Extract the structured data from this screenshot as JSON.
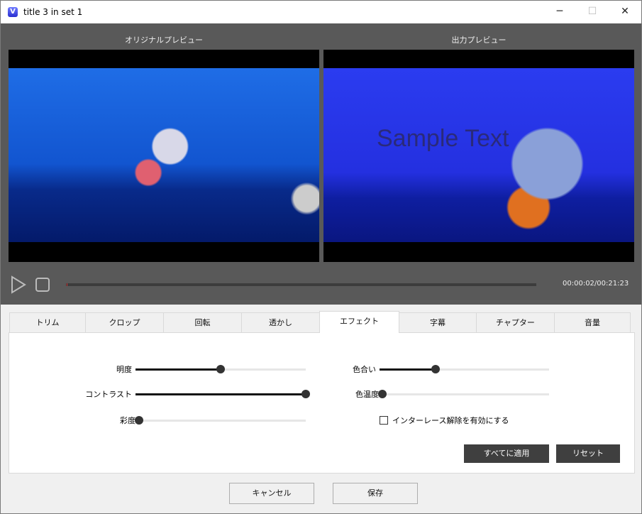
{
  "window": {
    "title": "title 3 in set 1",
    "icon": "app-v-icon",
    "minimize": "─",
    "maximize": "☐",
    "close": "✕"
  },
  "preview": {
    "original_label": "オリジナルプレビュー",
    "output_label": "出力プレビュー",
    "overlay_text": "Sample Text"
  },
  "player": {
    "time": "00:00:02/00:21:23",
    "progress": 0.002
  },
  "tabs": [
    "トリム",
    "クロップ",
    "回転",
    "透かし",
    "エフェクト",
    "字幕",
    "チャプター",
    "音量"
  ],
  "active_tab": "エフェクト",
  "effects": {
    "brightness": {
      "label": "明度",
      "value": 0.5
    },
    "contrast": {
      "label": "コントラスト",
      "value": 1.0
    },
    "saturation": {
      "label": "彩度",
      "value": 0.0
    },
    "hue": {
      "label": "色合い",
      "value": 0.33
    },
    "temperature": {
      "label": "色温度",
      "value": 0.0
    },
    "deinterlace": {
      "label": "インターレース解除を有効にする",
      "checked": false
    },
    "apply_all": "すべてに適用",
    "reset": "リセット"
  },
  "footer": {
    "cancel": "キャンセル",
    "save": "保存"
  }
}
